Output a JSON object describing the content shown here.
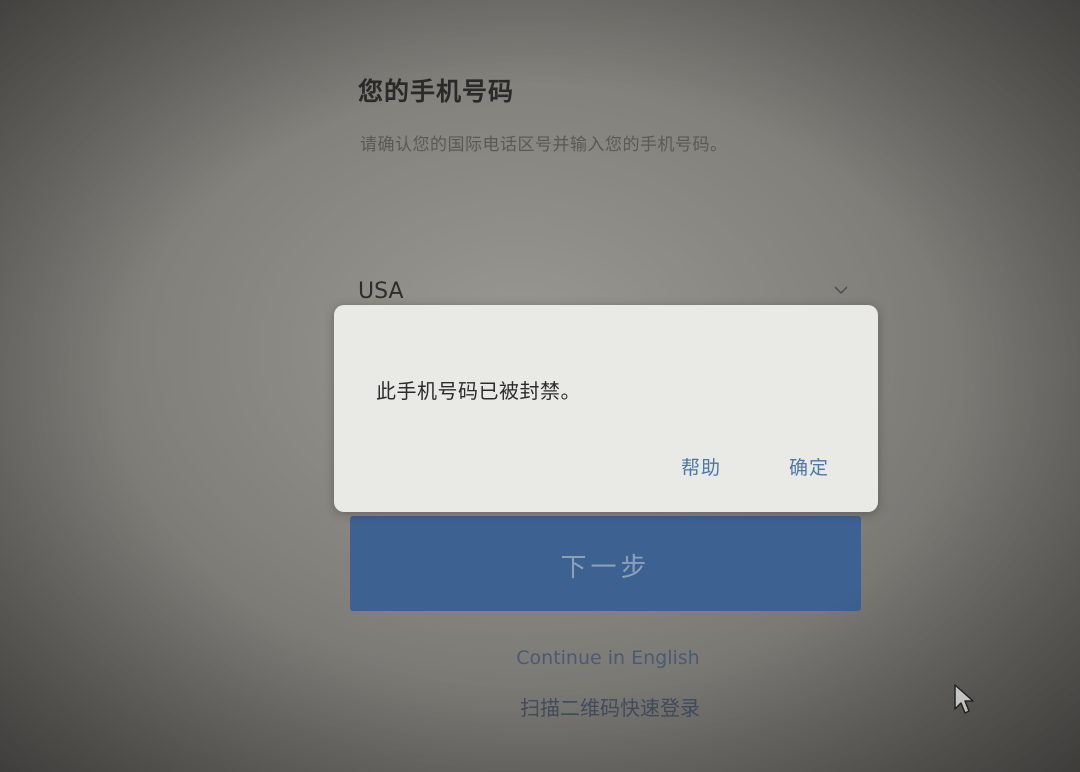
{
  "page": {
    "title": "您的手机号码",
    "subtitle": "请确认您的国际电话区号并输入您的手机号码。"
  },
  "country_select": {
    "value": "USA",
    "icon": "chevron-down-icon"
  },
  "next_button": {
    "label": "下一步"
  },
  "links": {
    "continue_english": "Continue in English",
    "qr_login": "扫描二维码快速登录"
  },
  "dialog": {
    "message": "此手机号码已被封禁。",
    "help_label": "帮助",
    "ok_label": "确定"
  },
  "colors": {
    "primary_button": "#3d6191",
    "dialog_button_text": "#4a79aa",
    "dialog_background": "#e9e9e6"
  }
}
